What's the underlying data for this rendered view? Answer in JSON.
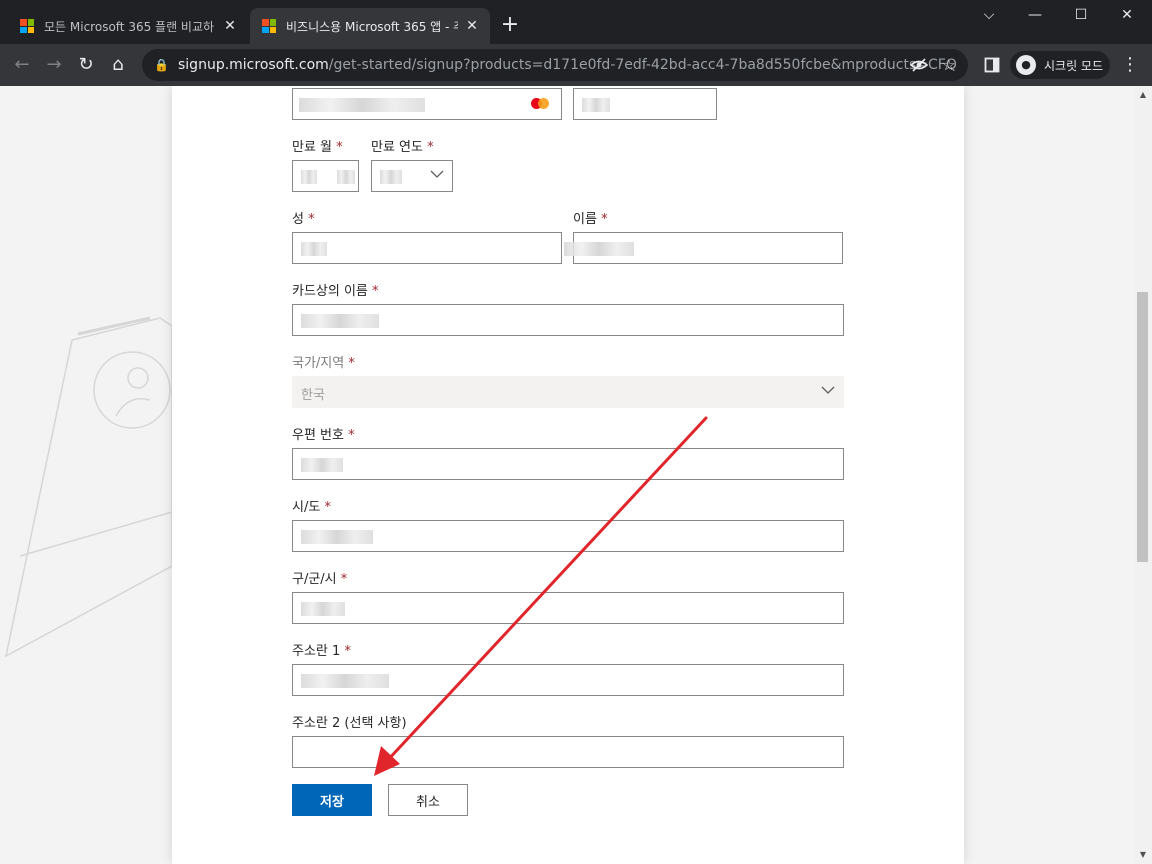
{
  "browser": {
    "tabs": [
      {
        "title": "모든 Microsoft 365 플랜 비교하",
        "active": false
      },
      {
        "title": "비즈니스용 Microsoft 365 앱 - 주",
        "active": true
      }
    ],
    "url": {
      "host": "signup.microsoft.com",
      "path": "/get-started/signup?products=d171e0fd-7edf-42bd-acc4-7ba8d550fcbe&mproducts=CFQ..."
    },
    "incognito_label": "시크릿 모드"
  },
  "form": {
    "expiry_month_label": "만료 월",
    "expiry_year_label": "만료 연도",
    "last_name_label": "성",
    "first_name_label": "이름",
    "name_on_card_label": "카드상의 이름",
    "country_label": "국가/지역",
    "country_value": "한국",
    "postal_code_label": "우편 번호",
    "state_label": "시/도",
    "city_label": "구/군/시",
    "address1_label": "주소란 1",
    "address2_label": "주소란 2 (선택 사항)",
    "required_mark": "*"
  },
  "buttons": {
    "save": "저장",
    "cancel": "취소"
  },
  "colors": {
    "primary_button": "#0067b8",
    "annotation_arrow": "#e0262b",
    "required_mark": "#a4262c"
  }
}
